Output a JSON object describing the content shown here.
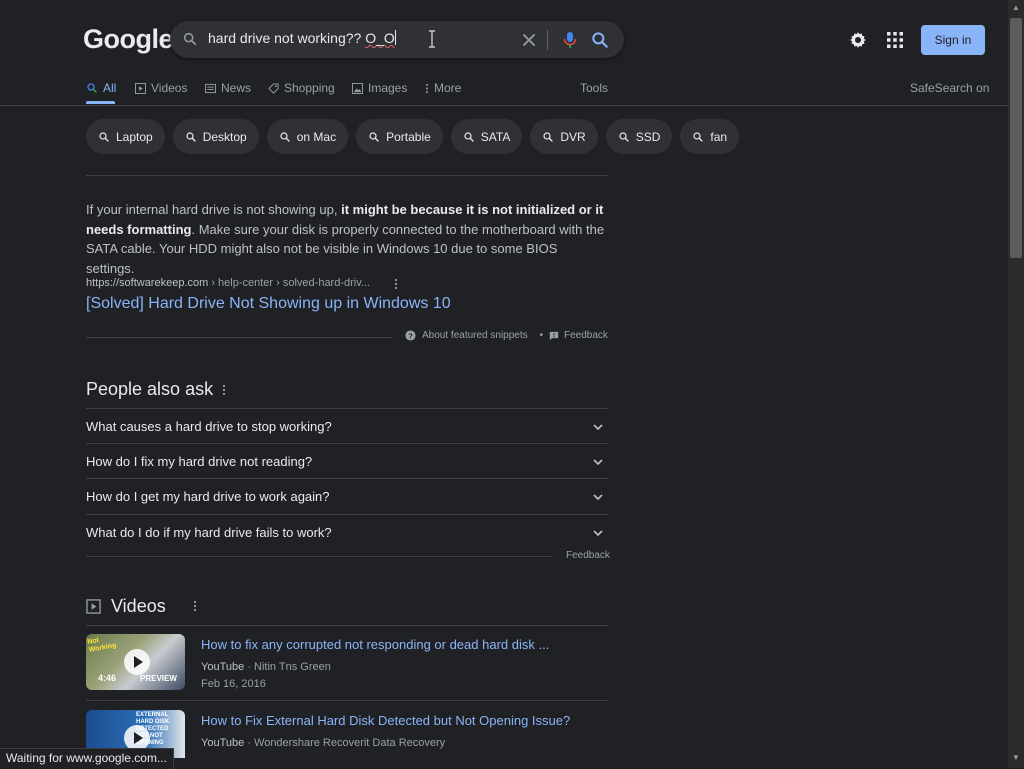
{
  "header": {
    "logo": {
      "letters": [
        "G",
        "o",
        "o",
        "g",
        "l",
        "e"
      ]
    },
    "search": {
      "query_main": "hard drive not working?? ",
      "query_tail": "O_O"
    },
    "signin_label": "Sign in"
  },
  "tabs": [
    {
      "label": "All",
      "icon": "search-icon",
      "active": true
    },
    {
      "label": "Videos",
      "icon": "video-icon"
    },
    {
      "label": "News",
      "icon": "news-icon"
    },
    {
      "label": "Shopping",
      "icon": "tag-icon"
    },
    {
      "label": "Images",
      "icon": "image-icon"
    },
    {
      "label": "More",
      "icon": "more-vert-icon"
    }
  ],
  "tools_label": "Tools",
  "safesearch_label": "SafeSearch on",
  "chips": [
    "Laptop",
    "Desktop",
    "on Mac",
    "Portable",
    "SATA",
    "DVR",
    "SSD",
    "fan"
  ],
  "featured_snippet": {
    "text_before": "If your internal hard drive is not showing up, ",
    "text_bold": "it might be because it is not initialized or it needs formatting",
    "text_after": ". Make sure your disk is properly connected to the motherboard with the SATA cable. Your HDD might also not be visible in Windows 10 due to some BIOS settings.",
    "cite_domain": "https://softwarekeep.com",
    "cite_path": " › help-center › solved-hard-driv...",
    "title": "[Solved] Hard Drive Not Showing up in Windows 10",
    "about_label": "About featured snippets",
    "feedback_label": "Feedback"
  },
  "people_also_ask": {
    "title": "People also ask",
    "questions": [
      "What causes a hard drive to stop working?",
      "How do I fix my hard drive not reading?",
      "How do I get my hard drive to work again?",
      "What do I do if my hard drive fails to work?"
    ],
    "feedback_label": "Feedback"
  },
  "videos": {
    "title": "Videos",
    "items": [
      {
        "title": "How to fix any corrupted not responding or dead hard disk ...",
        "source": "YouTube",
        "channel": "Nitin Tns Green",
        "date": "Feb 16, 2016",
        "duration": "4:46",
        "preview_label": "PREVIEW",
        "thumb_text": "Not Working"
      },
      {
        "title": "How to Fix External Hard Disk Detected but Not Opening Issue?",
        "source": "YouTube",
        "channel": "Wondershare Recoverit Data Recovery",
        "thumb_text": "EXTERNAL HARD DISK DETECTED BUT NOT OPENING"
      }
    ]
  },
  "status_bar": {
    "text": "Waiting for www.google.com..."
  },
  "colors": {
    "background": "#202124",
    "link": "#8ab4f8",
    "chip_bg": "#303134",
    "signin_bg": "#8ab4f8"
  }
}
